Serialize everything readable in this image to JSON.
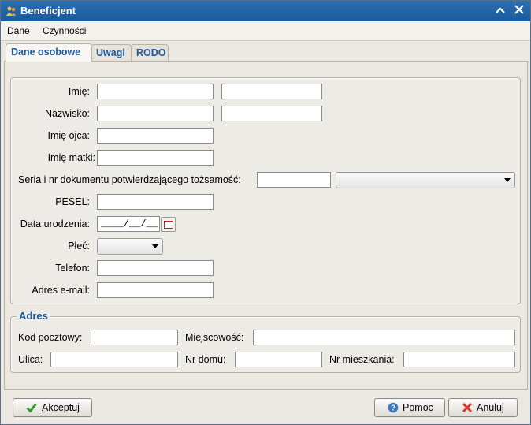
{
  "window": {
    "title": "Beneficjent",
    "icons": {
      "app": "app-icon",
      "collapse": "chevron-up-icon",
      "close": "close-icon"
    }
  },
  "menu": {
    "items": [
      {
        "label": "Dane",
        "accel": "D",
        "rest": "ane"
      },
      {
        "label": "Czynności",
        "accel": "C",
        "rest": "zynności"
      }
    ]
  },
  "tabs": [
    {
      "label": "Dane osobowe",
      "active": true
    },
    {
      "label": "Uwagi",
      "active": false
    },
    {
      "label": "RODO",
      "active": false
    }
  ],
  "personal": {
    "first_name_label": "Imię:",
    "first_name": "",
    "second_name": "",
    "surname_label": "Nazwisko:",
    "surname": "",
    "surname2": "",
    "father_label": "Imię ojca:",
    "father": "",
    "mother_label": "Imię matki:",
    "mother": "",
    "document_label": "Seria i nr dokumentu potwierdzającego tożsamość:",
    "document_number": "",
    "document_type": "",
    "pesel_label": "PESEL:",
    "pesel": "",
    "birth_label": "Data urodzenia:",
    "birth_mask": "____/__/__",
    "gender_label": "Płeć:",
    "gender": "",
    "phone_label": "Telefon:",
    "phone": "",
    "email_label": "Adres e-mail:",
    "email": ""
  },
  "address": {
    "title": "Adres",
    "postal_label": "Kod pocztowy:",
    "postal": "",
    "city_label": "Miejscowość:",
    "city": "",
    "street_label": "Ulica:",
    "street": "",
    "house_label": "Nr domu:",
    "house": "",
    "apartment_label": "Nr mieszkania:",
    "apartment": ""
  },
  "buttons": {
    "accept": {
      "accel": "A",
      "rest": "kceptuj",
      "icon": "checkmark-icon"
    },
    "help": {
      "label": "Pomoc",
      "icon": "help-icon"
    },
    "cancel": {
      "pre": "A",
      "accel": "n",
      "rest": "uluj",
      "icon": "cancel-x-icon"
    }
  },
  "colors": {
    "titlebar": "#1f64a8",
    "accent": "#1f5a9c",
    "accept_icon": "#2e9b2e",
    "cancel_icon": "#d23c2c",
    "help_icon": "#3b78c4"
  }
}
